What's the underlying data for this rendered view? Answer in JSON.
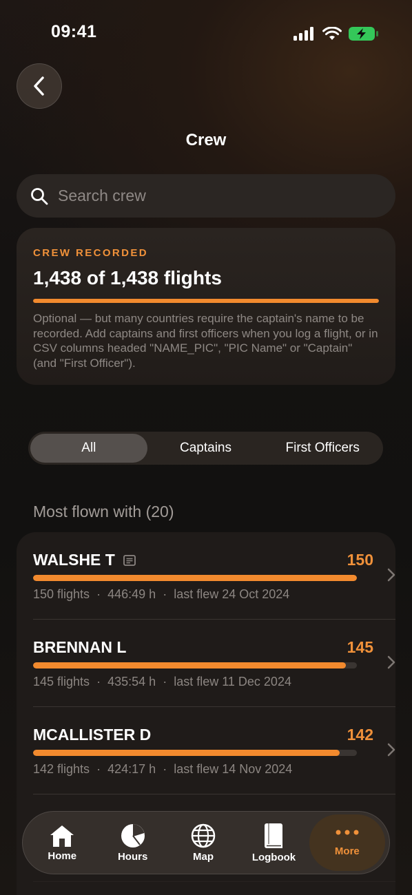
{
  "status_bar": {
    "time": "09:41"
  },
  "page": {
    "title": "Crew"
  },
  "search": {
    "placeholder": "Search crew"
  },
  "summary": {
    "eyebrow": "CREW RECORDED",
    "value": "1,438 of 1,438 flights",
    "progress": 1.0,
    "note": "Optional — but many countries require the captain's name to be recorded. Add captains and first officers when you log a flight, or in CSV columns headed \"NAME_PIC\", \"PIC Name\" or \"Captain\" (and \"First Officer\")."
  },
  "filter": {
    "segments": [
      {
        "label": "All",
        "selected": true
      },
      {
        "label": "Captains",
        "selected": false
      },
      {
        "label": "First Officers",
        "selected": false
      }
    ]
  },
  "list": {
    "header": "Most flown with (20)",
    "items": [
      {
        "name": "WALSHE T",
        "count": "150",
        "fill": 1.0,
        "flights": "150 flights",
        "hours": "446:49 h",
        "last": "last flew 24 Oct 2024",
        "has_note_icon": true
      },
      {
        "name": "BRENNAN L",
        "count": "145",
        "fill": 0.967,
        "flights": "145 flights",
        "hours": "435:54 h",
        "last": "last flew 11 Dec 2024",
        "has_note_icon": false
      },
      {
        "name": "MCALLISTER D",
        "count": "142",
        "fill": 0.947,
        "flights": "142 flights",
        "hours": "424:17 h",
        "last": "last flew 14 Nov 2024",
        "has_note_icon": false
      }
    ],
    "separator": "·"
  },
  "tab_bar": {
    "tabs": [
      {
        "label": "Home",
        "icon": "home-icon"
      },
      {
        "label": "Hours",
        "icon": "pie-chart-icon"
      },
      {
        "label": "Map",
        "icon": "globe-icon"
      },
      {
        "label": "Logbook",
        "icon": "book-icon"
      },
      {
        "label": "More",
        "icon": "more-icon",
        "active": true
      }
    ]
  },
  "colors": {
    "accent": "#f28a2e",
    "accent_text": "#f0913a",
    "battery": "#34c759"
  }
}
